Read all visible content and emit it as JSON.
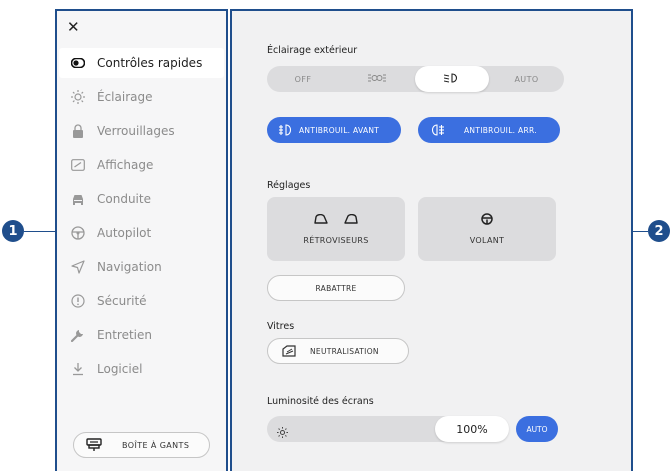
{
  "callouts": [
    "1",
    "2"
  ],
  "sidebar": {
    "close_icon": "close-icon",
    "items": [
      {
        "label": "Contrôles rapides",
        "icon": "quick-controls-icon",
        "active": true
      },
      {
        "label": "Éclairage",
        "icon": "sun-icon"
      },
      {
        "label": "Verrouillages",
        "icon": "lock-icon"
      },
      {
        "label": "Affichage",
        "icon": "display-icon"
      },
      {
        "label": "Conduite",
        "icon": "car-icon"
      },
      {
        "label": "Autopilot",
        "icon": "steering-wheel-icon"
      },
      {
        "label": "Navigation",
        "icon": "navigation-icon"
      },
      {
        "label": "Sécurité",
        "icon": "alert-icon"
      },
      {
        "label": "Entretien",
        "icon": "wrench-icon"
      },
      {
        "label": "Logiciel",
        "icon": "download-icon"
      }
    ],
    "glovebox_label": "BOÎTE À GANTS"
  },
  "panel": {
    "exterior_lighting": {
      "label": "Éclairage extérieur",
      "options": [
        "OFF",
        "",
        "",
        "AUTO"
      ],
      "selected_index": 2
    },
    "fog_front_label": "ANTIBROUIL. AVANT",
    "fog_rear_label": "ANTIBROUIL. ARR.",
    "settings": {
      "label": "Réglages",
      "mirrors_label": "RÉTROVISEURS",
      "wheel_label": "VOLANT",
      "fold_label": "RABATTRE"
    },
    "windows": {
      "label": "Vitres",
      "neutralize_label": "NEUTRALISATION"
    },
    "brightness": {
      "label": "Luminosité des écrans",
      "value": "100%",
      "auto_label": "AUTO"
    }
  },
  "colors": {
    "accent": "#3b6fe0",
    "callout": "#1f4e8c"
  }
}
